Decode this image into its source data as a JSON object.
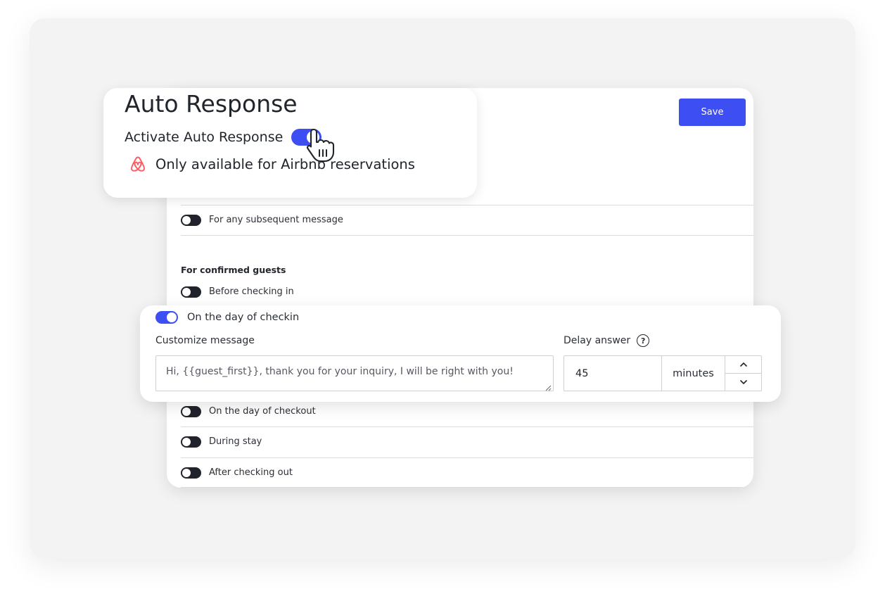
{
  "colors": {
    "accent": "#3d4ff2",
    "toggle_off": "#20232b",
    "airbnb": "#ff5a5f"
  },
  "toolbar": {
    "save_label": "Save"
  },
  "popup": {
    "title": "Auto Response",
    "activate_label": "Activate Auto Response",
    "activate_on": true,
    "airbnb_note": "Only available for Airbnb reservations"
  },
  "settings": {
    "subsequent_label": "For any subsequent message",
    "confirmed_title": "For confirmed guests",
    "before_checkin_label": "Before checking in",
    "checkout_day_label": "On the day of checkout",
    "during_stay_label": "During stay",
    "after_checkout_label": "After checking out"
  },
  "checkin": {
    "label": "On the day of checkin",
    "enabled": true,
    "customize_label": "Customize message",
    "message": "Hi, {{guest_first}}, thank you for your inquiry, I will be right with you!",
    "delay_label": "Delay answer",
    "delay_value": "45",
    "delay_unit": "minutes"
  },
  "icons": [
    "airbnb-icon",
    "pointer-hand-icon",
    "help-icon",
    "chevron-up-icon",
    "chevron-down-icon",
    "resize-handle-icon"
  ]
}
